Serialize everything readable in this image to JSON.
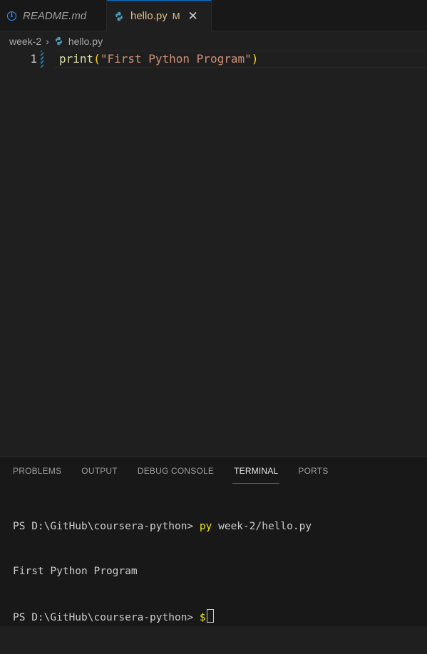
{
  "tabs": [
    {
      "label": "README.md",
      "icon": "info-icon",
      "active": false
    },
    {
      "label": "hello.py",
      "icon": "python-file-icon",
      "modified_badge": "M",
      "active": true
    }
  ],
  "breadcrumb": {
    "folder": "week-2",
    "file": "hello.py"
  },
  "editor": {
    "lines": [
      {
        "number": "1",
        "fn": "print",
        "open_paren": "(",
        "string": "\"First Python Program\"",
        "close_paren": ")"
      }
    ]
  },
  "panel": {
    "tabs": [
      "PROBLEMS",
      "OUTPUT",
      "DEBUG CONSOLE",
      "TERMINAL",
      "PORTS"
    ],
    "active_tab": "TERMINAL"
  },
  "terminal": {
    "prompt1": "PS D:\\GitHub\\coursera-python> ",
    "cmd1_exe": "py",
    "cmd1_args": " week-2/hello.py",
    "output1": "First Python Program",
    "prompt2": "PS D:\\GitHub\\coursera-python> ",
    "partial_input": "$"
  },
  "colors": {
    "accent": "#0078d4",
    "modified": "#e2c08d",
    "string": "#ce9178",
    "function": "#dcdcaa"
  }
}
